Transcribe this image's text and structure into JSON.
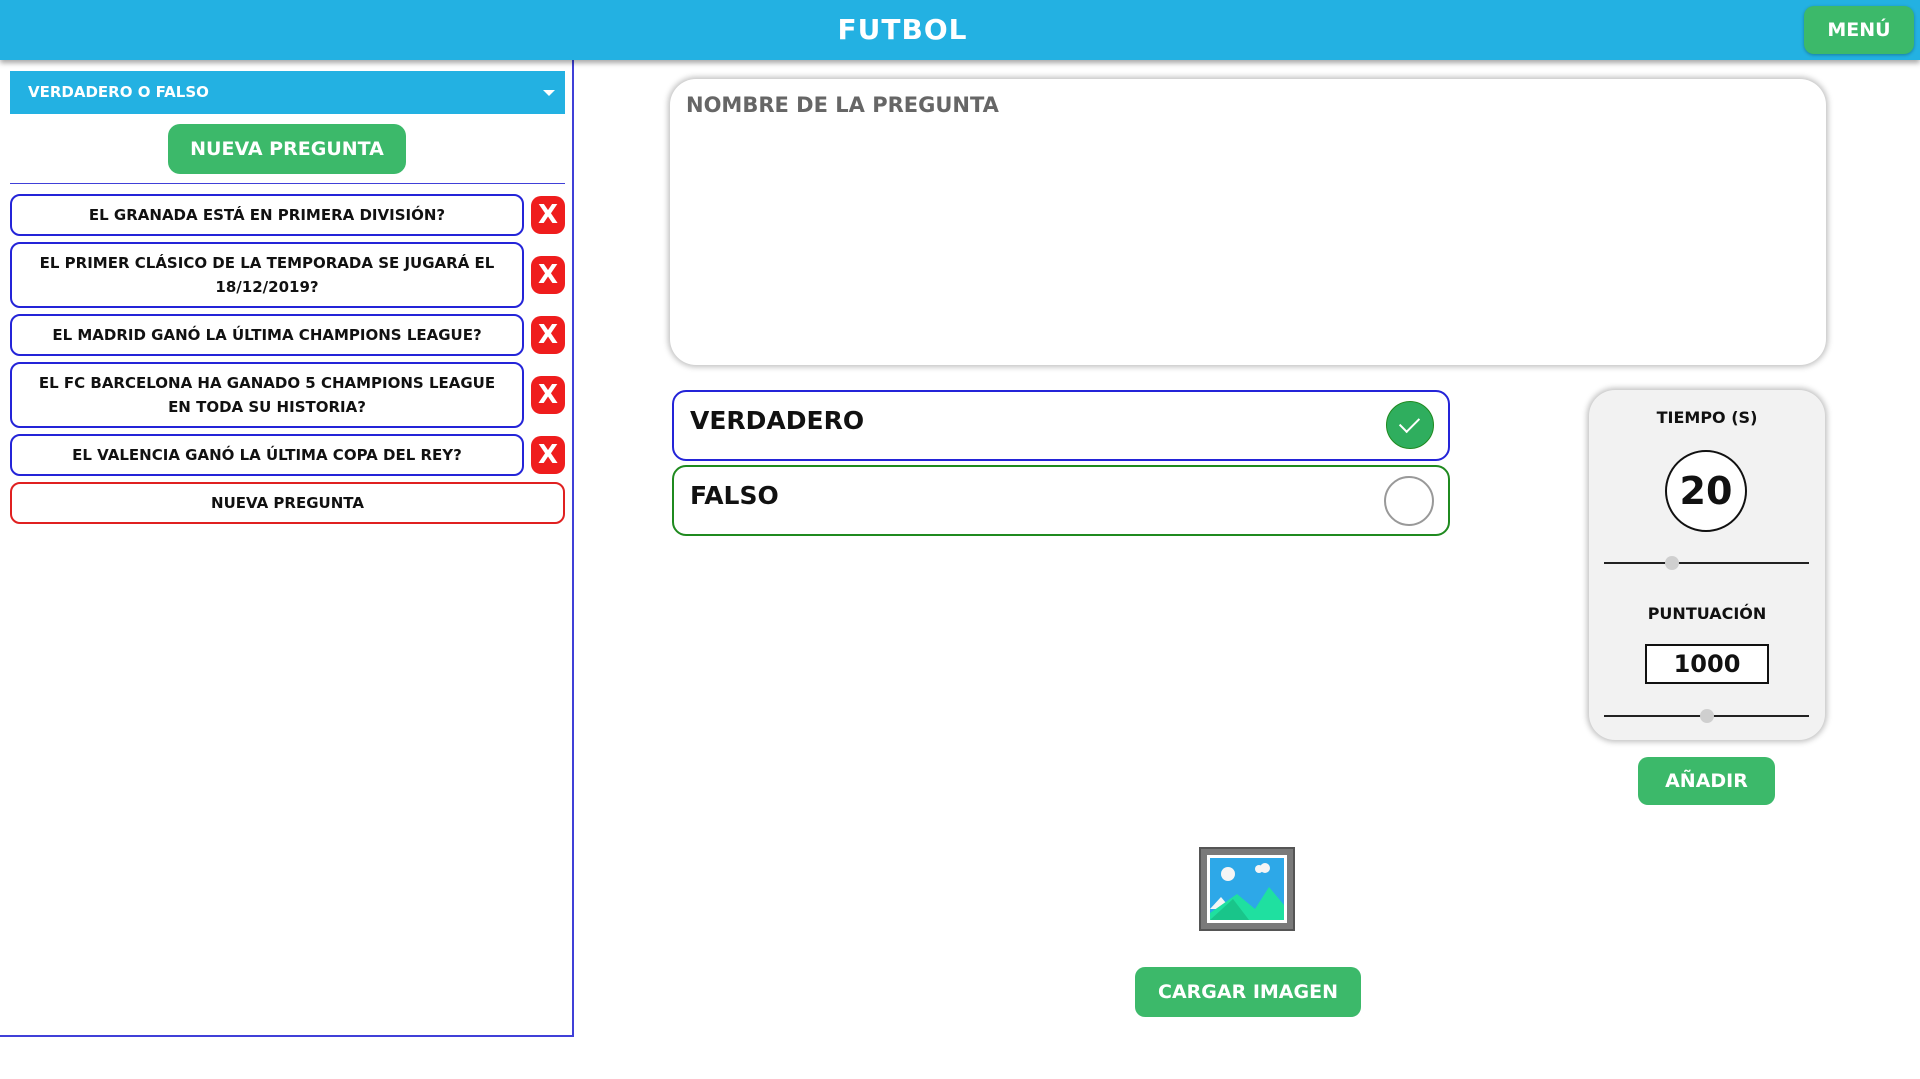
{
  "header": {
    "title": "FUTBOL",
    "menu_label": "MENÚ"
  },
  "sidebar": {
    "type_select": "VERDADERO O FALSO",
    "new_question_button": "NUEVA PREGUNTA",
    "questions": [
      "EL GRANADA ESTÁ EN PRIMERA DIVISIÓN?",
      "EL PRIMER CLÁSICO DE LA TEMPORADA SE JUGARÁ EL 18/12/2019?",
      "EL MADRID GANÓ LA ÚLTIMA CHAMPIONS LEAGUE?",
      "EL FC BARCELONA HA GANADO 5 CHAMPIONS LEAGUE EN TODA SU HISTORIA?",
      "EL VALENCIA GANÓ LA ÚLTIMA COPA DEL REY?"
    ],
    "delete_glyph": "X",
    "new_question_item": "NUEVA PREGUNTA"
  },
  "editor": {
    "question_placeholder": "NOMBRE DE LA PREGUNTA",
    "answers": [
      {
        "label": "VERDADERO",
        "correct": true
      },
      {
        "label": "FALSO",
        "correct": false
      }
    ]
  },
  "settings": {
    "time_heading": "TIEMPO (S)",
    "time_value": "20",
    "time_slider_fraction": 0.33,
    "points_heading": "PUNTUACIÓN",
    "points_value": "1000",
    "points_slider_fraction": 0.5,
    "add_button": "AÑADIR"
  },
  "image": {
    "icon": "image-icon",
    "upload_button": "CARGAR IMAGEN"
  },
  "colors": {
    "header_blue": "#23b1e2",
    "button_green": "#3cb96a",
    "delete_red": "#ef1d1d",
    "border_blue": "#2424d8"
  }
}
